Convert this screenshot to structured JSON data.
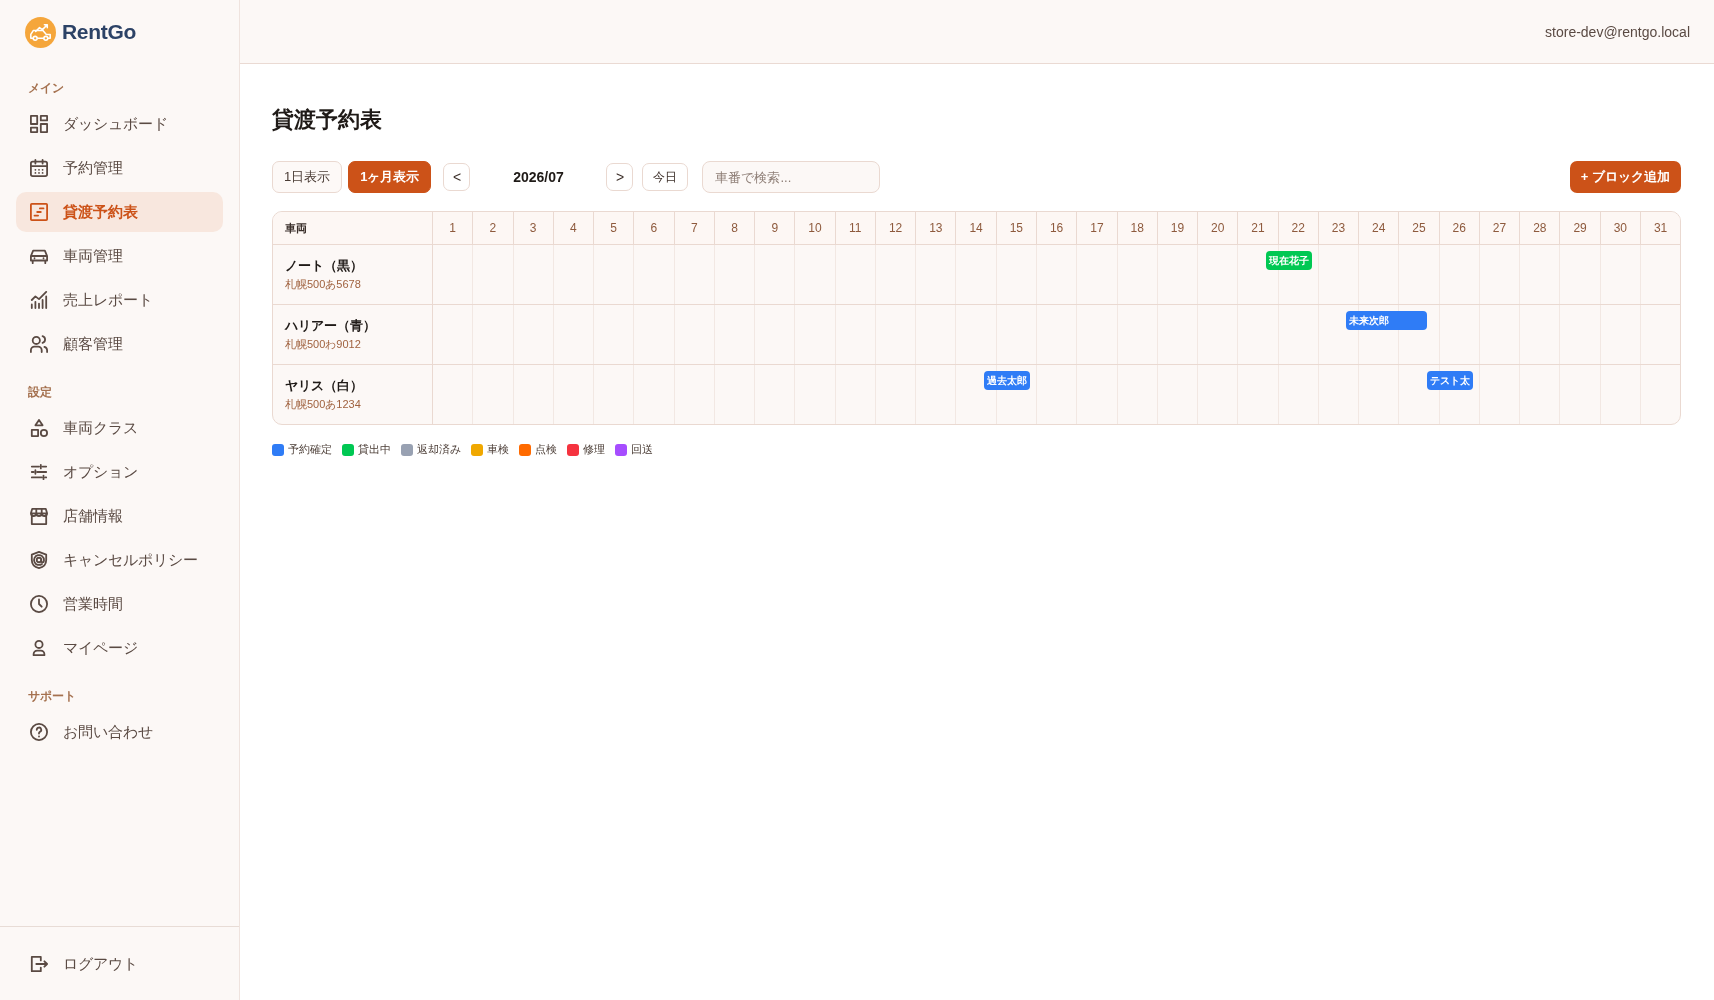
{
  "sidebar": {
    "brand": "RentGo",
    "sections": [
      {
        "label": "メイン",
        "items": [
          {
            "label": "ダッシュボード",
            "selected": false
          },
          {
            "label": "予約管理",
            "selected": false
          },
          {
            "label": "貸渡予約表",
            "selected": true
          },
          {
            "label": "車両管理",
            "selected": false
          },
          {
            "label": "売上レポート",
            "selected": false
          },
          {
            "label": "顧客管理",
            "selected": false
          }
        ]
      },
      {
        "label": "設定",
        "items": [
          {
            "label": "車両クラス",
            "selected": false
          },
          {
            "label": "オプション",
            "selected": false
          },
          {
            "label": "店舗情報",
            "selected": false
          },
          {
            "label": "キャンセルポリシー",
            "selected": false
          },
          {
            "label": "営業時間",
            "selected": false
          },
          {
            "label": "マイページ",
            "selected": false
          }
        ]
      },
      {
        "label": "サポート",
        "items": [
          {
            "label": "お問い合わせ",
            "selected": false
          }
        ]
      }
    ],
    "logout": "ログアウト"
  },
  "header": {
    "user_email": "store-dev@rentgo.local"
  },
  "page": {
    "title": "貸渡予約表"
  },
  "toolbar": {
    "view_tabs": [
      {
        "label": "1日表示",
        "selected": false
      },
      {
        "label": "1ヶ月表示",
        "selected": true
      }
    ],
    "prev_button": "<",
    "month": "2026/07",
    "next_button": ">",
    "today_button": "今日",
    "search": {
      "placeholder": "車番で検索..."
    },
    "add_button": "+ ブロック追加"
  },
  "schedule": {
    "vehicle_column": "車両",
    "days": [
      "1",
      "2",
      "3",
      "4",
      "5",
      "6",
      "7",
      "8",
      "9",
      "10",
      "11",
      "12",
      "13",
      "14",
      "15",
      "16",
      "17",
      "18",
      "19",
      "20",
      "21",
      "22",
      "23",
      "24",
      "25",
      "26",
      "27",
      "28",
      "29",
      "30",
      "31"
    ],
    "rows": [
      {
        "name": "ノート（黒）",
        "plate": "札幌500あ5678",
        "cells": [
          null,
          null,
          null,
          null,
          null,
          null,
          null,
          null,
          null,
          null,
          null,
          null,
          null,
          null,
          null,
          null,
          null,
          null,
          null,
          null,
          {
            "booking": {
              "label": "現在花子",
              "color": "#00c853"
            }
          },
          {
            "continued": true
          },
          null,
          null,
          null,
          null,
          null,
          null,
          null,
          null,
          null
        ]
      },
      {
        "name": "ハリアー（青）",
        "plate": "札幌500わ9012",
        "cells": [
          null,
          null,
          null,
          null,
          null,
          null,
          null,
          null,
          null,
          null,
          null,
          null,
          null,
          null,
          null,
          null,
          null,
          null,
          null,
          null,
          null,
          null,
          {
            "booking": {
              "label": "未来次郎",
              "color": "#2f7cf6"
            }
          },
          {
            "continued": true
          },
          {
            "continued": true
          },
          null,
          null,
          null,
          null,
          null,
          null
        ]
      },
      {
        "name": "ヤリス（白）",
        "plate": "札幌500あ1234",
        "cells": [
          null,
          null,
          null,
          null,
          null,
          null,
          null,
          null,
          null,
          null,
          null,
          null,
          null,
          {
            "booking": {
              "label": "過去太郎",
              "color": "#2f7cf6"
            }
          },
          {
            "continued": true
          },
          null,
          null,
          null,
          null,
          null,
          null,
          null,
          null,
          null,
          {
            "booking": {
              "label": "テスト太",
              "color": "#2f7cf6"
            }
          },
          {
            "continued": true
          },
          null,
          null,
          null,
          null,
          null
        ]
      }
    ]
  },
  "legend": [
    {
      "label": "予約確定",
      "color": "#2f7cf6"
    },
    {
      "label": "貸出中",
      "color": "#00c853"
    },
    {
      "label": "返却済み",
      "color": "#98a1b2"
    },
    {
      "label": "車検",
      "color": "#f0a800"
    },
    {
      "label": "点検",
      "color": "#ff6a00"
    },
    {
      "label": "修理",
      "color": "#f5333f"
    },
    {
      "label": "回送",
      "color": "#a64dff"
    }
  ]
}
